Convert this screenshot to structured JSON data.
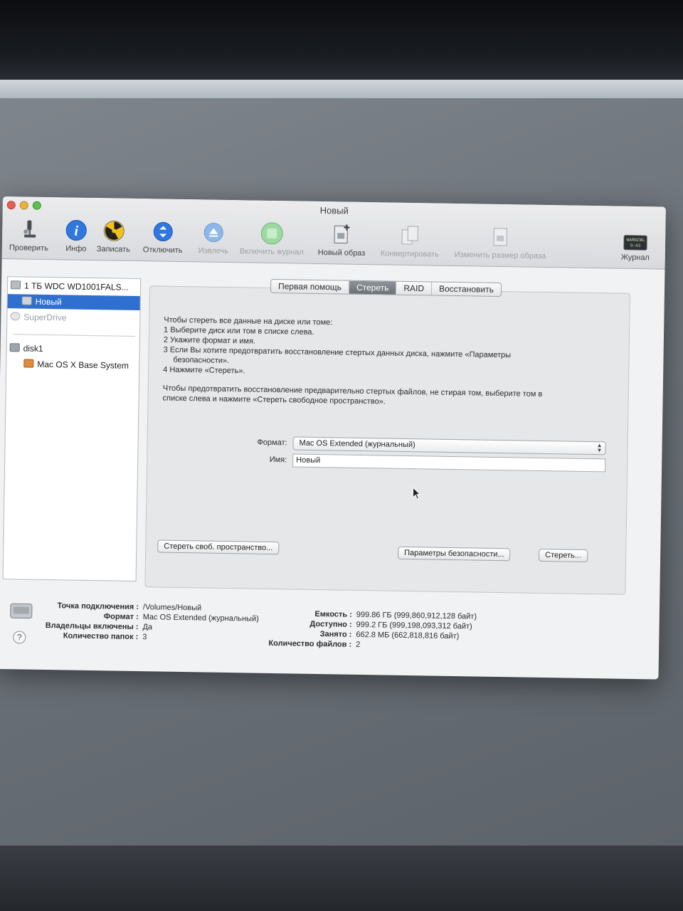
{
  "window": {
    "title": "Новый"
  },
  "toolbar": {
    "verify": "Проверить",
    "info": "Инфо",
    "burn": "Записать",
    "unmount": "Отключить",
    "eject": "Извлечь",
    "journal_enable": "Включить журнал",
    "new_image": "Новый образ",
    "convert": "Конвертировать",
    "resize": "Изменить размер образа",
    "log": "Журнал",
    "log_badge": "WARNING\n9:43"
  },
  "sidebar": {
    "items": [
      {
        "label": "1 ТБ WDC WD1001FALS..."
      },
      {
        "label": "Новый"
      },
      {
        "label": "SuperDrive"
      },
      {
        "label": "disk1"
      },
      {
        "label": "Mac OS X Base System"
      }
    ]
  },
  "tabs": [
    "Первая помощь",
    "Стереть",
    "RAID",
    "Восстановить"
  ],
  "instructions": {
    "intro": "Чтобы стереть все данные на диске или томе:",
    "step1": "1  Выберите диск или том в списке слева.",
    "step2": "2  Укажите формат и имя.",
    "step3": "3  Если Вы хотите предотвратить восстановление стертых данных диска, нажмите «Параметры",
    "step3b": "безопасности».",
    "step4": "4  Нажмите «Стереть».",
    "para2a": "Чтобы предотвратить восстановление предварительно стертых файлов, не стирая том, выберите том в",
    "para2b": "списке слева и нажмите «Стереть свободное пространство»."
  },
  "form": {
    "format_label": "Формат:",
    "format_value": "Mac OS Extended (журнальный)",
    "name_label": "Имя:",
    "name_value": "Новый"
  },
  "buttons": {
    "erase_free": "Стереть своб. пространство...",
    "security": "Параметры безопасности...",
    "erase": "Стереть..."
  },
  "footer": {
    "mount_label": "Точка подключения :",
    "mount_value": "/Volumes/Новый",
    "format_label": "Формат :",
    "format_value": "Mac OS Extended (журнальный)",
    "owners_label": "Владельцы включены :",
    "owners_value": "Да",
    "folders_label": "Количество папок :",
    "folders_value": "3",
    "capacity_label": "Емкость :",
    "capacity_value": "999.86 ГБ (999,860,912,128 байт)",
    "available_label": "Доступно :",
    "available_value": "999.2 ГБ (999,198,093,312 байт)",
    "used_label": "Занято :",
    "used_value": "662.8 МБ (662,818,816 байт)",
    "files_label": "Количество файлов :",
    "files_value": "2",
    "help": "?"
  },
  "colors": {
    "selection": "#2f6fd0",
    "active_tab": "#7b8086",
    "info_icon": "#2f78e0"
  }
}
